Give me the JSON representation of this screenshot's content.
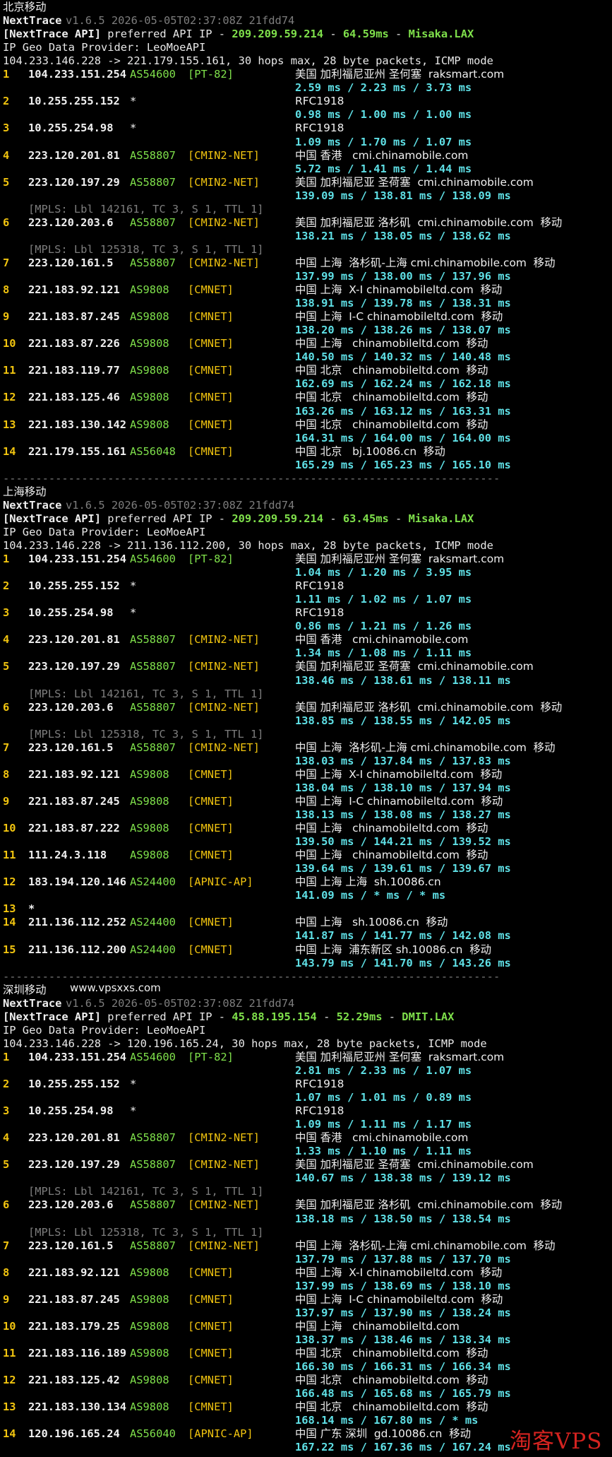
{
  "colors": {
    "background": "#000000",
    "text": "#d8d8d8",
    "gray": "#7d7d7d",
    "green": "#7fe04b",
    "yellow": "#f1c40f",
    "cyan": "#5fe0e6",
    "watermark_red": "#d52320"
  },
  "watermarks": {
    "site": "www.vpsxxs.com",
    "logo": "淘客VPS"
  },
  "sections": [
    {
      "title": "北京移动",
      "tool": "NextTrace",
      "version_line": "v1.6.5 2026-05-05T02:37:08Z 21fdd74",
      "api_label": "[NextTrace API]",
      "api_text": " preferred API IP - ",
      "api_ip": "209.209.59.214",
      "api_sep": " - ",
      "api_latency": "64.59ms",
      "api_sep2": " - ",
      "api_node": "Misaka.LAX",
      "geo_provider": "IP Geo Data Provider: LeoMoeAPI",
      "route_summary": "104.233.146.228 -> 221.179.155.161, 30 hops max, 28 byte packets, ICMP mode",
      "hops": [
        {
          "n": "1",
          "ip": "104.233.151.254",
          "asn": "AS54600",
          "tag": "[PT-82]",
          "geo": "美国 加利福尼亚州 圣何塞  raksmart.com",
          "rtt": "2.59 ms / 2.23 ms / 3.73 ms"
        },
        {
          "n": "2",
          "ip": "10.255.255.152",
          "asn": "*",
          "tag": "",
          "geo": "RFC1918",
          "rtt": "0.98 ms / 1.00 ms / 1.00 ms"
        },
        {
          "n": "3",
          "ip": "10.255.254.98",
          "asn": "*",
          "tag": "",
          "geo": "RFC1918",
          "rtt": "1.09 ms / 1.70 ms / 1.07 ms"
        },
        {
          "n": "4",
          "ip": "223.120.201.81",
          "asn": "AS58807",
          "tag": "[CMIN2-NET]",
          "geo": "中国 香港   cmi.chinamobile.com",
          "rtt": "5.72 ms / 1.41 ms / 1.44 ms"
        },
        {
          "n": "5",
          "ip": "223.120.197.29",
          "asn": "AS58807",
          "tag": "[CMIN2-NET]",
          "geo": "美国 加利福尼亚 圣荷塞  cmi.chinamobile.com",
          "rtt": "139.09 ms / 138.81 ms / 138.09 ms"
        },
        {
          "mpls": "[MPLS: Lbl 142161, TC 3, S 1, TTL 1]"
        },
        {
          "n": "6",
          "ip": "223.120.203.6",
          "asn": "AS58807",
          "tag": "[CMIN2-NET]",
          "geo": "美国 加利福尼亚 洛杉矶  cmi.chinamobile.com  移动",
          "rtt": "138.21 ms / 138.05 ms / 138.62 ms"
        },
        {
          "mpls": "[MPLS: Lbl 125318, TC 3, S 1, TTL 1]"
        },
        {
          "n": "7",
          "ip": "223.120.161.5",
          "asn": "AS58807",
          "tag": "[CMIN2-NET]",
          "geo": "中国 上海  洛杉矶-上海 cmi.chinamobile.com  移动",
          "rtt": "137.99 ms / 138.00 ms / 137.96 ms"
        },
        {
          "n": "8",
          "ip": "221.183.92.121",
          "asn": "AS9808",
          "tag": "[CMNET]",
          "geo": "中国 上海  X-I chinamobileltd.com  移动",
          "rtt": "138.91 ms / 139.78 ms / 138.31 ms"
        },
        {
          "n": "9",
          "ip": "221.183.87.245",
          "asn": "AS9808",
          "tag": "[CMNET]",
          "geo": "中国 上海  I-C chinamobileltd.com  移动",
          "rtt": "138.20 ms / 138.26 ms / 138.07 ms"
        },
        {
          "n": "10",
          "ip": "221.183.87.226",
          "asn": "AS9808",
          "tag": "[CMNET]",
          "geo": "中国 上海   chinamobileltd.com  移动",
          "rtt": "140.50 ms / 140.32 ms / 140.48 ms"
        },
        {
          "n": "11",
          "ip": "221.183.119.77",
          "asn": "AS9808",
          "tag": "[CMNET]",
          "geo": "中国 北京   chinamobileltd.com  移动",
          "rtt": "162.69 ms / 162.24 ms / 162.18 ms"
        },
        {
          "n": "12",
          "ip": "221.183.125.46",
          "asn": "AS9808",
          "tag": "[CMNET]",
          "geo": "中国 北京   chinamobileltd.com  移动",
          "rtt": "163.26 ms / 163.12 ms / 163.31 ms"
        },
        {
          "n": "13",
          "ip": "221.183.130.142",
          "asn": "AS9808",
          "tag": "[CMNET]",
          "geo": "中国 北京   chinamobileltd.com  移动",
          "rtt": "164.31 ms / 164.00 ms / 164.00 ms"
        },
        {
          "n": "14",
          "ip": "221.179.155.161",
          "asn": "AS56048",
          "tag": "[CMNET]",
          "geo": "中国 北京   bj.10086.cn  移动",
          "rtt": "165.29 ms / 165.23 ms / 165.10 ms"
        }
      ],
      "separator": "----------------------------------------------------------------------------"
    },
    {
      "title": "上海移动",
      "tool": "NextTrace",
      "version_line": "v1.6.5 2026-05-05T02:37:08Z 21fdd74",
      "api_label": "[NextTrace API]",
      "api_text": " preferred API IP - ",
      "api_ip": "209.209.59.214",
      "api_sep": " - ",
      "api_latency": "63.45ms",
      "api_sep2": " - ",
      "api_node": "Misaka.LAX",
      "geo_provider": "IP Geo Data Provider: LeoMoeAPI",
      "route_summary": "104.233.146.228 -> 211.136.112.200, 30 hops max, 28 byte packets, ICMP mode",
      "hops": [
        {
          "n": "1",
          "ip": "104.233.151.254",
          "asn": "AS54600",
          "tag": "[PT-82]",
          "geo": "美国 加利福尼亚州 圣何塞  raksmart.com",
          "rtt": "1.04 ms / 1.20 ms / 3.95 ms"
        },
        {
          "n": "2",
          "ip": "10.255.255.152",
          "asn": "*",
          "tag": "",
          "geo": "RFC1918",
          "rtt": "1.11 ms / 1.02 ms / 1.07 ms"
        },
        {
          "n": "3",
          "ip": "10.255.254.98",
          "asn": "*",
          "tag": "",
          "geo": "RFC1918",
          "rtt": "0.86 ms / 1.21 ms / 1.26 ms"
        },
        {
          "n": "4",
          "ip": "223.120.201.81",
          "asn": "AS58807",
          "tag": "[CMIN2-NET]",
          "geo": "中国 香港   cmi.chinamobile.com",
          "rtt": "1.34 ms / 1.08 ms / 1.11 ms"
        },
        {
          "n": "5",
          "ip": "223.120.197.29",
          "asn": "AS58807",
          "tag": "[CMIN2-NET]",
          "geo": "美国 加利福尼亚 圣荷塞  cmi.chinamobile.com",
          "rtt": "138.46 ms / 138.61 ms / 138.11 ms"
        },
        {
          "mpls": "[MPLS: Lbl 142161, TC 3, S 1, TTL 1]"
        },
        {
          "n": "6",
          "ip": "223.120.203.6",
          "asn": "AS58807",
          "tag": "[CMIN2-NET]",
          "geo": "美国 加利福尼亚 洛杉矶  cmi.chinamobile.com  移动",
          "rtt": "138.85 ms / 138.55 ms / 142.05 ms"
        },
        {
          "mpls": "[MPLS: Lbl 125318, TC 3, S 1, TTL 1]"
        },
        {
          "n": "7",
          "ip": "223.120.161.5",
          "asn": "AS58807",
          "tag": "[CMIN2-NET]",
          "geo": "中国 上海  洛杉矶-上海 cmi.chinamobile.com  移动",
          "rtt": "138.03 ms / 137.84 ms / 137.83 ms"
        },
        {
          "n": "8",
          "ip": "221.183.92.121",
          "asn": "AS9808",
          "tag": "[CMNET]",
          "geo": "中国 上海  X-I chinamobileltd.com  移动",
          "rtt": "138.04 ms / 138.10 ms / 137.94 ms"
        },
        {
          "n": "9",
          "ip": "221.183.87.245",
          "asn": "AS9808",
          "tag": "[CMNET]",
          "geo": "中国 上海  I-C chinamobileltd.com  移动",
          "rtt": "138.13 ms / 138.08 ms / 138.27 ms"
        },
        {
          "n": "10",
          "ip": "221.183.87.222",
          "asn": "AS9808",
          "tag": "[CMNET]",
          "geo": "中国 上海   chinamobileltd.com  移动",
          "rtt": "139.50 ms / 144.21 ms / 139.52 ms"
        },
        {
          "n": "11",
          "ip": "111.24.3.118",
          "asn": "AS9808",
          "tag": "[CMNET]",
          "geo": "中国 上海   chinamobileltd.com  移动",
          "rtt": "139.64 ms / 139.61 ms / 139.67 ms"
        },
        {
          "n": "12",
          "ip": "183.194.120.146",
          "asn": "AS24400",
          "tag": "[APNIC-AP]",
          "geo": "中国 上海 上海  sh.10086.cn",
          "rtt": "141.09 ms / * ms / * ms"
        },
        {
          "n": "13",
          "ip": "*",
          "asn": "",
          "tag": "",
          "geo": "",
          "rtt": ""
        },
        {
          "n": "14",
          "ip": "211.136.112.252",
          "asn": "AS24400",
          "tag": "[CMNET]",
          "geo": "中国 上海   sh.10086.cn  移动",
          "rtt": "141.87 ms / 141.77 ms / 142.08 ms"
        },
        {
          "n": "15",
          "ip": "211.136.112.200",
          "asn": "AS24400",
          "tag": "[CMNET]",
          "geo": "中国 上海  浦东新区 sh.10086.cn  移动",
          "rtt": "143.79 ms / 141.70 ms / 143.26 ms"
        }
      ],
      "separator": "----------------------------------------------------------------------------"
    },
    {
      "title": "深圳移动",
      "tool": "NextTrace",
      "version_line": "v1.6.5 2026-05-05T02:37:08Z 21fdd74",
      "api_label": "[NextTrace API]",
      "api_text": " preferred API IP - ",
      "api_ip": "45.88.195.154",
      "api_sep": " - ",
      "api_latency": "52.29ms",
      "api_sep2": " - ",
      "api_node": "DMIT.LAX",
      "geo_provider": "IP Geo Data Provider: LeoMoeAPI",
      "route_summary": "104.233.146.228 -> 120.196.165.24, 30 hops max, 28 byte packets, ICMP mode",
      "hops": [
        {
          "n": "1",
          "ip": "104.233.151.254",
          "asn": "AS54600",
          "tag": "[PT-82]",
          "geo": "美国 加利福尼亚州 圣何塞  raksmart.com",
          "rtt": "2.81 ms / 2.33 ms / 1.07 ms"
        },
        {
          "n": "2",
          "ip": "10.255.255.152",
          "asn": "*",
          "tag": "",
          "geo": "RFC1918",
          "rtt": "1.07 ms / 1.01 ms / 0.89 ms"
        },
        {
          "n": "3",
          "ip": "10.255.254.98",
          "asn": "*",
          "tag": "",
          "geo": "RFC1918",
          "rtt": "1.09 ms / 1.11 ms / 1.17 ms"
        },
        {
          "n": "4",
          "ip": "223.120.201.81",
          "asn": "AS58807",
          "tag": "[CMIN2-NET]",
          "geo": "中国 香港   cmi.chinamobile.com",
          "rtt": "1.33 ms / 1.10 ms / 1.11 ms"
        },
        {
          "n": "5",
          "ip": "223.120.197.29",
          "asn": "AS58807",
          "tag": "[CMIN2-NET]",
          "geo": "美国 加利福尼亚 圣荷塞  cmi.chinamobile.com",
          "rtt": "140.67 ms / 138.38 ms / 139.12 ms"
        },
        {
          "mpls": "[MPLS: Lbl 142161, TC 3, S 1, TTL 1]"
        },
        {
          "n": "6",
          "ip": "223.120.203.6",
          "asn": "AS58807",
          "tag": "[CMIN2-NET]",
          "geo": "美国 加利福尼亚 洛杉矶  cmi.chinamobile.com  移动",
          "rtt": "138.18 ms / 138.50 ms / 138.54 ms"
        },
        {
          "mpls": "[MPLS: Lbl 125318, TC 3, S 1, TTL 1]"
        },
        {
          "n": "7",
          "ip": "223.120.161.5",
          "asn": "AS58807",
          "tag": "[CMIN2-NET]",
          "geo": "中国 上海  洛杉矶-上海 cmi.chinamobile.com  移动",
          "rtt": "137.79 ms / 137.88 ms / 137.70 ms"
        },
        {
          "n": "8",
          "ip": "221.183.92.121",
          "asn": "AS9808",
          "tag": "[CMNET]",
          "geo": "中国 上海  X-I chinamobileltd.com  移动",
          "rtt": "137.99 ms / 138.69 ms / 138.10 ms"
        },
        {
          "n": "9",
          "ip": "221.183.87.245",
          "asn": "AS9808",
          "tag": "[CMNET]",
          "geo": "中国 上海  I-C chinamobileltd.com  移动",
          "rtt": "137.97 ms / 137.90 ms / 138.24 ms"
        },
        {
          "n": "10",
          "ip": "221.183.179.25",
          "asn": "AS9808",
          "tag": "[CMNET]",
          "geo": "中国 上海   chinamobileltd.com",
          "rtt": "138.37 ms / 138.46 ms / 138.34 ms"
        },
        {
          "n": "11",
          "ip": "221.183.116.189",
          "asn": "AS9808",
          "tag": "[CMNET]",
          "geo": "中国 北京   chinamobileltd.com  移动",
          "rtt": "166.30 ms / 166.31 ms / 166.34 ms"
        },
        {
          "n": "12",
          "ip": "221.183.125.42",
          "asn": "AS9808",
          "tag": "[CMNET]",
          "geo": "中国 北京   chinamobileltd.com  移动",
          "rtt": "166.48 ms / 165.68 ms / 165.79 ms"
        },
        {
          "n": "13",
          "ip": "221.183.130.134",
          "asn": "AS9808",
          "tag": "[CMNET]",
          "geo": "中国 北京   chinamobileltd.com  移动",
          "rtt": "168.14 ms / 167.80 ms / * ms"
        },
        {
          "n": "14",
          "ip": "120.196.165.24",
          "asn": "AS56040",
          "tag": "[APNIC-AP]",
          "geo": "中国 广东 深圳  gd.10086.cn  移动",
          "rtt": "167.22 ms / 167.36 ms / 167.24 ms"
        }
      ]
    }
  ]
}
